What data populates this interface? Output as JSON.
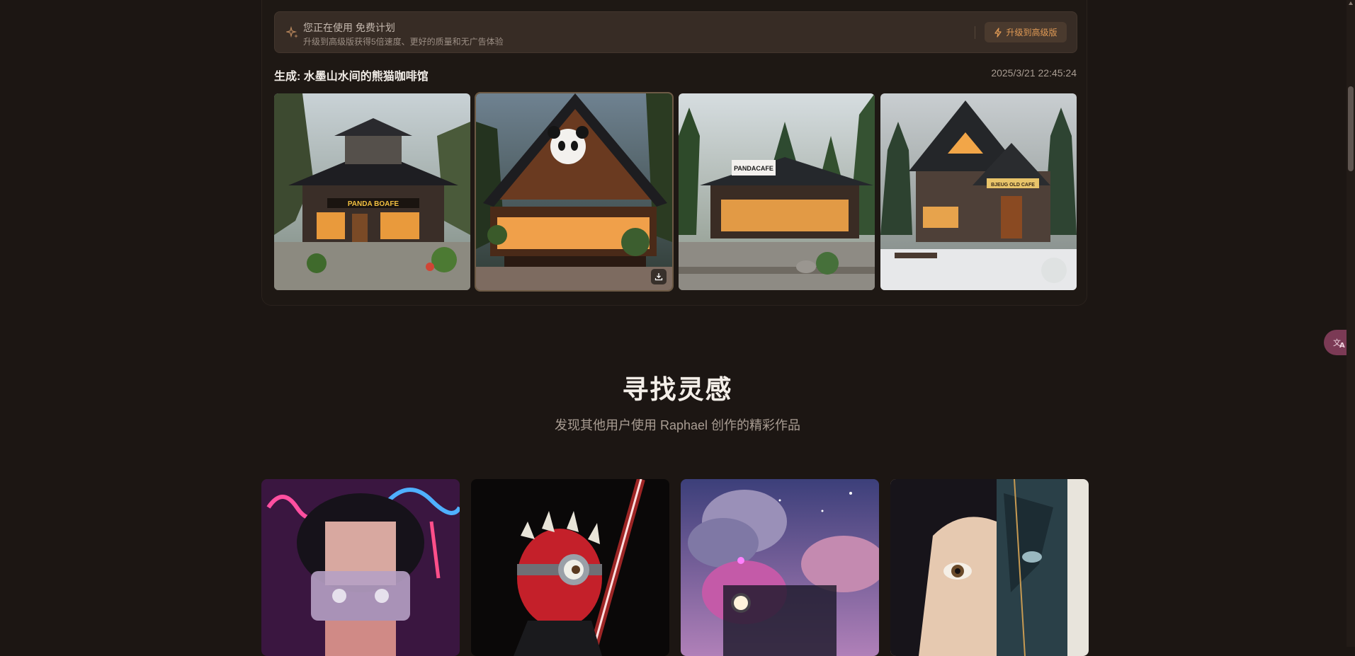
{
  "plan_banner": {
    "title": "您正在使用 免费计划",
    "subtitle": "升级到高级版获得5倍速度、更好的质量和无广告体验",
    "upgrade_label": "升级到高级版",
    "icon": "sparkle-icon",
    "upgrade_icon": "lightning-icon"
  },
  "generation": {
    "title": "生成: 水墨山水间的熊猫咖啡馆",
    "timestamp": "2025/3/21 22:45:24",
    "images": [
      {
        "sign": "PANDA BOAFE"
      },
      {
        "sign": ""
      },
      {
        "sign": "PANDACAFE"
      },
      {
        "sign": "BJEUG OLD CAFE"
      }
    ],
    "selected_index": 1
  },
  "inspiration": {
    "title": "寻找灵感",
    "subtitle": "发现其他用户使用 Raphael 创作的精彩作品"
  },
  "colors": {
    "background": "#1c1613",
    "banner": "#372c25",
    "accent": "#e09a55",
    "translate": "#7b3a55"
  }
}
